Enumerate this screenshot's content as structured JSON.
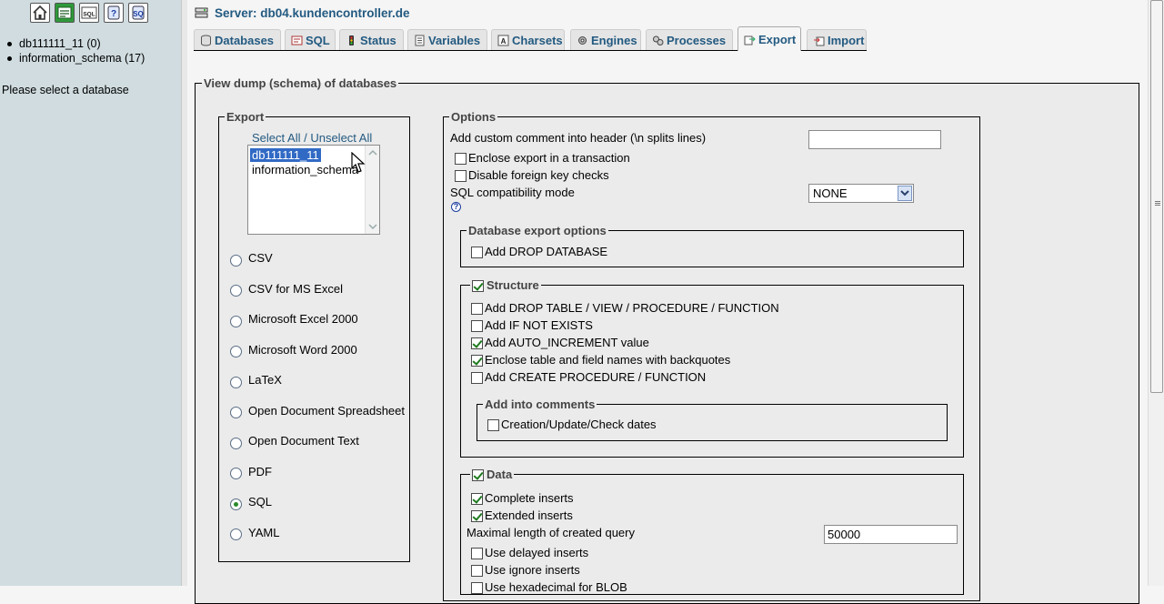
{
  "nav": {
    "icons": [
      "home-icon",
      "query-window-icon",
      "sql-icon",
      "docs-icon",
      "help-icon"
    ],
    "databases": [
      {
        "name": "db111111_11",
        "count": "(0)"
      },
      {
        "name": "information_schema",
        "count": "(17)"
      }
    ],
    "prompt": "Please select a database"
  },
  "header": {
    "server_label": "Server: db04.kundencontroller.de"
  },
  "tabs": [
    {
      "label": "Databases",
      "icon": "databases-icon"
    },
    {
      "label": "SQL",
      "icon": "sql-icon"
    },
    {
      "label": "Status",
      "icon": "status-icon"
    },
    {
      "label": "Variables",
      "icon": "variables-icon"
    },
    {
      "label": "Charsets",
      "icon": "charsets-icon"
    },
    {
      "label": "Engines",
      "icon": "engines-icon"
    },
    {
      "label": "Processes",
      "icon": "processes-icon"
    },
    {
      "label": "Export",
      "icon": "export-icon",
      "active": true
    },
    {
      "label": "Import",
      "icon": "import-icon"
    }
  ],
  "dump": {
    "legend": "View dump (schema) of databases",
    "export": {
      "legend": "Export",
      "select_all": "Select All",
      "separator": " / ",
      "unselect_all": "Unselect All",
      "databases": [
        "db111111_11",
        "information_schema"
      ],
      "selected": "db111111_11",
      "formats": [
        "CSV",
        "CSV for MS Excel",
        "Microsoft Excel 2000",
        "Microsoft Word 2000",
        "LaTeX",
        "Open Document Spreadsheet",
        "Open Document Text",
        "PDF",
        "SQL",
        "YAML"
      ],
      "selected_format": "SQL"
    },
    "options": {
      "legend": "Options",
      "custom_comment_label": "Add custom comment into header (\\n splits lines)",
      "custom_comment_value": "",
      "enclose_transaction": "Enclose export in a transaction",
      "disable_fk": "Disable foreign key checks",
      "compat_label": "SQL compatibility mode",
      "compat_value": "NONE",
      "db_export": {
        "legend": "Database export options",
        "add_drop_database": "Add DROP DATABASE"
      },
      "structure": {
        "legend": "Structure",
        "checked": true,
        "items": [
          {
            "label": "Add DROP TABLE / VIEW / PROCEDURE / FUNCTION",
            "checked": false
          },
          {
            "label": "Add IF NOT EXISTS",
            "checked": false
          },
          {
            "label": "Add AUTO_INCREMENT value",
            "checked": true
          },
          {
            "label": "Enclose table and field names with backquotes",
            "checked": true
          },
          {
            "label": "Add CREATE PROCEDURE / FUNCTION",
            "checked": false
          }
        ],
        "comments": {
          "legend": "Add into comments",
          "dates": "Creation/Update/Check dates"
        }
      },
      "data": {
        "legend": "Data",
        "checked": true,
        "complete_inserts": "Complete inserts",
        "extended_inserts": "Extended inserts",
        "max_query_label": "Maximal length of created query",
        "max_query_value": "50000",
        "delayed_inserts": "Use delayed inserts",
        "ignore_inserts": "Use ignore inserts",
        "hex_blob": "Use hexadecimal for BLOB"
      }
    }
  }
}
